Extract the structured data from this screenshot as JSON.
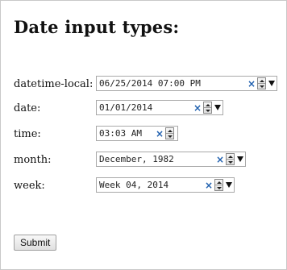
{
  "page": {
    "heading": "Date input types:",
    "submit_label": "Submit"
  },
  "fields": {
    "datetime_local": {
      "label": "datetime-local:",
      "value": "06/25/2014 07:00 PM"
    },
    "date": {
      "label": "date:",
      "value": "01/01/2014"
    },
    "time": {
      "label": "time:",
      "value": "03:03 AM"
    },
    "month": {
      "label": "month:",
      "value": "December, 1982"
    },
    "week": {
      "label": "week:",
      "value": "Week 04, 2014"
    }
  },
  "icons": {
    "clear": "×",
    "spinner": "up-down-arrows-icon",
    "dropdown": "triangle-down-icon"
  },
  "colors": {
    "clear_icon": "#1f5fae"
  }
}
